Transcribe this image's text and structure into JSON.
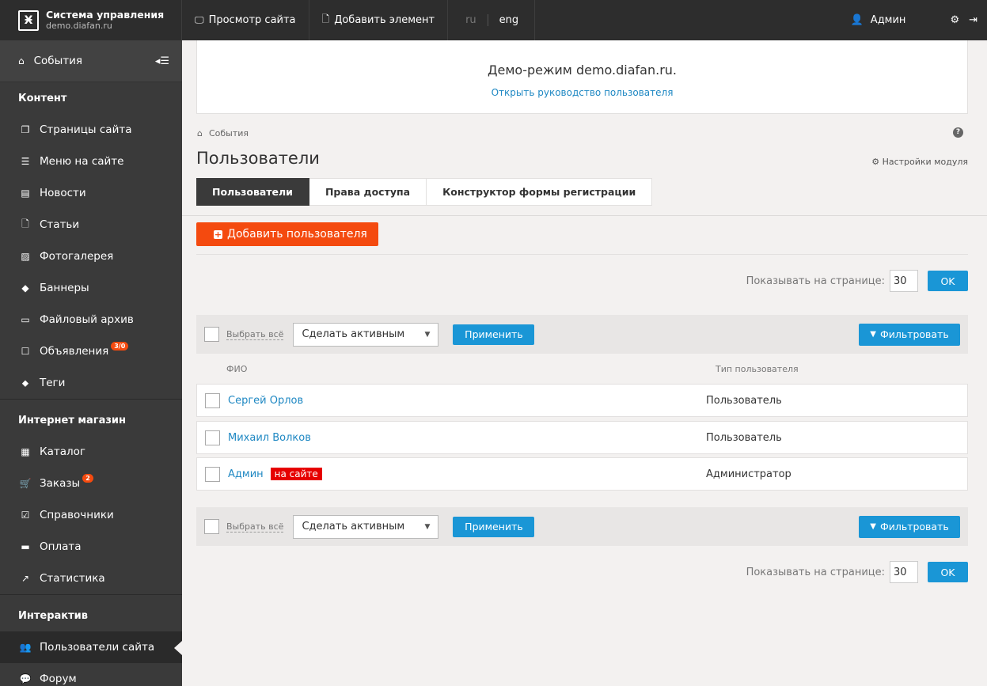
{
  "topbar": {
    "brand_title": "Система управления",
    "brand_subtitle": "demo.diafan.ru",
    "view_site": "Просмотр сайта",
    "add_element": "Добавить элемент",
    "lang_ru": "ru",
    "lang_eng": "eng",
    "admin": "Админ"
  },
  "sidebar": {
    "events": "События",
    "section_content": "Контент",
    "content_items": [
      {
        "label": "Страницы сайта",
        "icon": "pages-icon"
      },
      {
        "label": "Меню на сайте",
        "icon": "menu-icon"
      },
      {
        "label": "Новости",
        "icon": "news-icon"
      },
      {
        "label": "Статьи",
        "icon": "file-icon"
      },
      {
        "label": "Фотогалерея",
        "icon": "image-icon"
      },
      {
        "label": "Баннеры",
        "icon": "ticket-icon"
      },
      {
        "label": "Файловый архив",
        "icon": "folder-icon"
      },
      {
        "label": "Объявления",
        "icon": "square-icon",
        "badge": "3/0"
      },
      {
        "label": "Теги",
        "icon": "tag-icon"
      }
    ],
    "section_shop": "Интернет магазин",
    "shop_items": [
      {
        "label": "Каталог",
        "icon": "grid-icon"
      },
      {
        "label": "Заказы",
        "icon": "cart-icon",
        "badge": "2"
      },
      {
        "label": "Справочники",
        "icon": "check-icon"
      },
      {
        "label": "Оплата",
        "icon": "card-icon"
      },
      {
        "label": "Статистика",
        "icon": "chart-icon"
      }
    ],
    "section_interactive": "Интерактив",
    "interactive_items": [
      {
        "label": "Пользователи сайта",
        "icon": "users-icon"
      },
      {
        "label": "Форум",
        "icon": "comments-icon"
      }
    ]
  },
  "demo": {
    "title": "Демо-режим demo.diafan.ru.",
    "link": "Открыть руководство пользователя"
  },
  "breadcrumb": "События",
  "page_title": "Пользователи",
  "module_settings": "Настройки модуля",
  "tabs": [
    "Пользователи",
    "Права доступа",
    "Конструктор формы регистрации"
  ],
  "add_user": "Добавить пользователя",
  "perpage": {
    "label": "Показывать на странице:",
    "value": "30",
    "ok": "OK"
  },
  "actions": {
    "select_all": "Выбрать всё",
    "action_value": "Сделать активным",
    "apply": "Применить",
    "filter": "Фильтровать"
  },
  "table": {
    "col_name": "ФИО",
    "col_type": "Тип пользователя",
    "rows": [
      {
        "name": "Сергей Орлов",
        "type": "Пользователь"
      },
      {
        "name": "Михаил Волков",
        "type": "Пользователь"
      },
      {
        "name": "Админ",
        "type": "Администратор",
        "badge": "на сайте"
      }
    ]
  }
}
